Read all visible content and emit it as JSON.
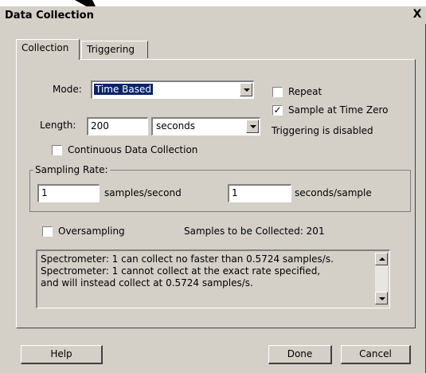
{
  "window": {
    "title": "Data Collection",
    "close_glyph": "X"
  },
  "tabs": [
    {
      "label": "Collection"
    },
    {
      "label": "Triggering"
    }
  ],
  "mode": {
    "label": "Mode:",
    "value": "Time Based"
  },
  "length": {
    "label": "Length:",
    "value": "200",
    "unit": "seconds"
  },
  "repeat": {
    "label": "Repeat",
    "checked": false
  },
  "sample_at_time_zero": {
    "label": "Sample at Time Zero",
    "checked": true
  },
  "triggering_status": "Triggering is disabled",
  "continuous": {
    "label": "Continuous Data Collection",
    "checked": false
  },
  "sampling_rate": {
    "title": "Sampling Rate:",
    "samples_per_second_value": "1",
    "samples_per_second_label": "samples/second",
    "seconds_per_sample_value": "1",
    "seconds_per_sample_label": "seconds/sample"
  },
  "oversampling": {
    "label": "Oversampling",
    "checked": false
  },
  "samples_to_collect": "Samples to be Collected:  201",
  "messages": [
    "Spectrometer: 1 can collect no faster than 0.5724 samples/s.",
    "Spectrometer: 1 cannot collect at the exact rate specified,",
    "and will instead collect at 0.5724 samples/s."
  ],
  "buttons": {
    "help": "Help",
    "done": "Done",
    "cancel": "Cancel"
  },
  "colors": {
    "dialog_bg": "#d4d0c8",
    "selection": "#0a246a"
  }
}
